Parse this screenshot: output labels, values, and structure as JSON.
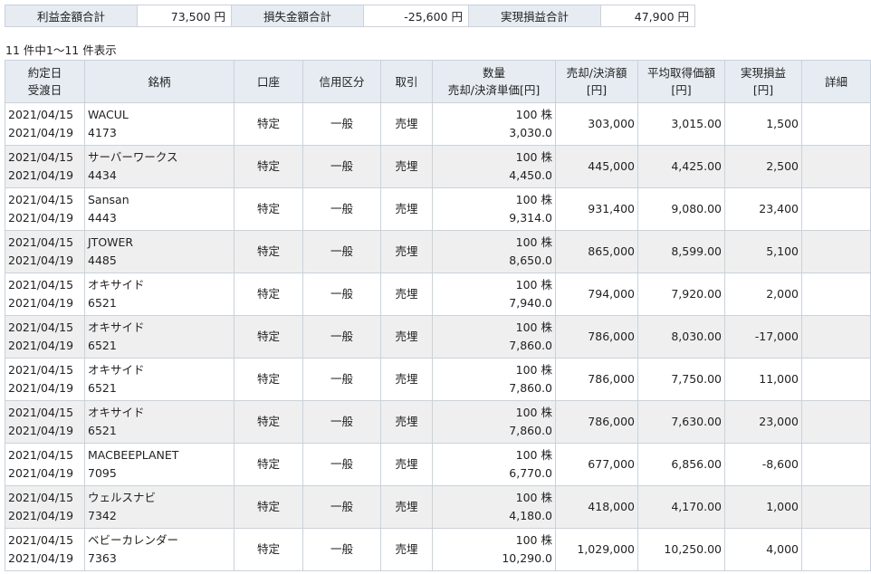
{
  "summary": [
    {
      "label": "利益金額合計",
      "value": "73,500 円"
    },
    {
      "label": "損失金額合計",
      "value": "-25,600 円"
    },
    {
      "label": "実現損益合計",
      "value": "47,900 円"
    }
  ],
  "count_text": "11 件中1～11 件表示",
  "headers": {
    "date": [
      "約定日",
      "受渡日"
    ],
    "name": "銘柄",
    "account": "口座",
    "credit": "信用区分",
    "trade": "取引",
    "qty": [
      "数量",
      "売却/決済単価[円]"
    ],
    "sale": [
      "売却/決済額",
      "[円]"
    ],
    "avg": [
      "平均取得価額",
      "[円]"
    ],
    "pl": [
      "実現損益",
      "[円]"
    ],
    "detail": "詳細"
  },
  "rows": [
    {
      "trade_date": "2021/04/15",
      "settle_date": "2021/04/19",
      "name": "WACUL",
      "code": "4173",
      "account": "特定",
      "credit": "一般",
      "trade": "売埋",
      "qty": "100 株",
      "price": "3,030.0",
      "sale": "303,000",
      "avg": "3,015.00",
      "pl": "1,500"
    },
    {
      "trade_date": "2021/04/15",
      "settle_date": "2021/04/19",
      "name": "サーバーワークス",
      "code": "4434",
      "account": "特定",
      "credit": "一般",
      "trade": "売埋",
      "qty": "100 株",
      "price": "4,450.0",
      "sale": "445,000",
      "avg": "4,425.00",
      "pl": "2,500"
    },
    {
      "trade_date": "2021/04/15",
      "settle_date": "2021/04/19",
      "name": "Sansan",
      "code": "4443",
      "account": "特定",
      "credit": "一般",
      "trade": "売埋",
      "qty": "100 株",
      "price": "9,314.0",
      "sale": "931,400",
      "avg": "9,080.00",
      "pl": "23,400"
    },
    {
      "trade_date": "2021/04/15",
      "settle_date": "2021/04/19",
      "name": "JTOWER",
      "code": "4485",
      "account": "特定",
      "credit": "一般",
      "trade": "売埋",
      "qty": "100 株",
      "price": "8,650.0",
      "sale": "865,000",
      "avg": "8,599.00",
      "pl": "5,100"
    },
    {
      "trade_date": "2021/04/15",
      "settle_date": "2021/04/19",
      "name": "オキサイド",
      "code": "6521",
      "account": "特定",
      "credit": "一般",
      "trade": "売埋",
      "qty": "100 株",
      "price": "7,940.0",
      "sale": "794,000",
      "avg": "7,920.00",
      "pl": "2,000"
    },
    {
      "trade_date": "2021/04/15",
      "settle_date": "2021/04/19",
      "name": "オキサイド",
      "code": "6521",
      "account": "特定",
      "credit": "一般",
      "trade": "売埋",
      "qty": "100 株",
      "price": "7,860.0",
      "sale": "786,000",
      "avg": "8,030.00",
      "pl": "-17,000"
    },
    {
      "trade_date": "2021/04/15",
      "settle_date": "2021/04/19",
      "name": "オキサイド",
      "code": "6521",
      "account": "特定",
      "credit": "一般",
      "trade": "売埋",
      "qty": "100 株",
      "price": "7,860.0",
      "sale": "786,000",
      "avg": "7,750.00",
      "pl": "11,000"
    },
    {
      "trade_date": "2021/04/15",
      "settle_date": "2021/04/19",
      "name": "オキサイド",
      "code": "6521",
      "account": "特定",
      "credit": "一般",
      "trade": "売埋",
      "qty": "100 株",
      "price": "7,860.0",
      "sale": "786,000",
      "avg": "7,630.00",
      "pl": "23,000"
    },
    {
      "trade_date": "2021/04/15",
      "settle_date": "2021/04/19",
      "name": "MACBEEPLANET",
      "code": "7095",
      "account": "特定",
      "credit": "一般",
      "trade": "売埋",
      "qty": "100 株",
      "price": "6,770.0",
      "sale": "677,000",
      "avg": "6,856.00",
      "pl": "-8,600"
    },
    {
      "trade_date": "2021/04/15",
      "settle_date": "2021/04/19",
      "name": "ウェルスナビ",
      "code": "7342",
      "account": "特定",
      "credit": "一般",
      "trade": "売埋",
      "qty": "100 株",
      "price": "4,180.0",
      "sale": "418,000",
      "avg": "4,170.00",
      "pl": "1,000"
    },
    {
      "trade_date": "2021/04/15",
      "settle_date": "2021/04/19",
      "name": "ベビーカレンダー",
      "code": "7363",
      "account": "特定",
      "credit": "一般",
      "trade": "売埋",
      "qty": "100 株",
      "price": "10,290.0",
      "sale": "1,029,000",
      "avg": "10,250.00",
      "pl": "4,000"
    }
  ]
}
